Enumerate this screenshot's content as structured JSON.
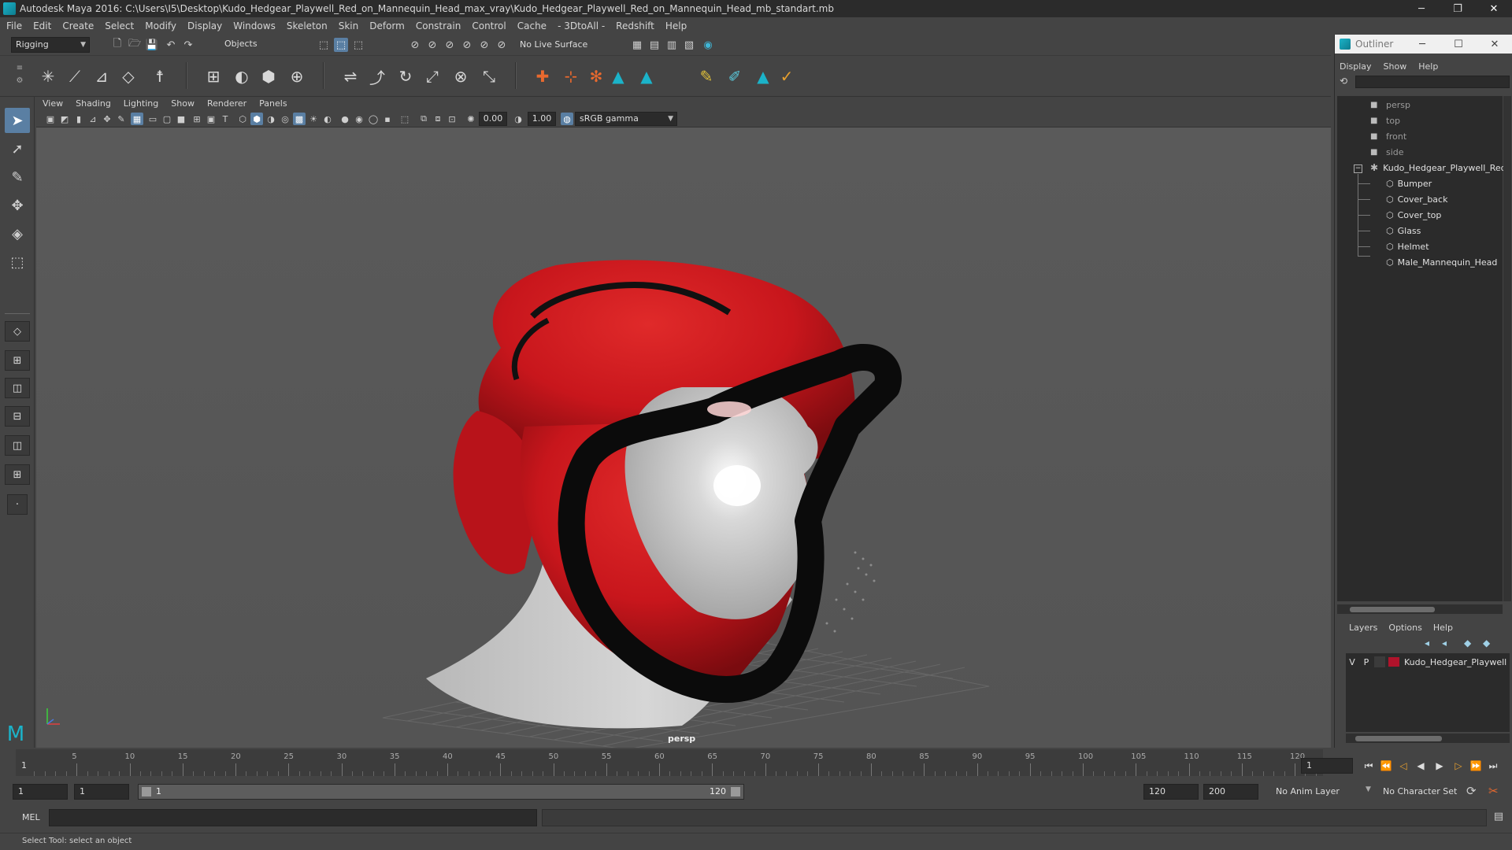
{
  "window": {
    "title": "Autodesk Maya 2016: C:\\Users\\I5\\Desktop\\Kudo_Hedgear_Playwell_Red_on_Mannequin_Head_max_vray\\Kudo_Hedgear_Playwell_Red_on_Mannequin_Head_mb_standart.mb",
    "minimize": "─",
    "restore": "❐",
    "close": "✕"
  },
  "menubar": {
    "items": [
      "File",
      "Edit",
      "Create",
      "Select",
      "Modify",
      "Display",
      "Windows",
      "Skeleton",
      "Skin",
      "Deform",
      "Constrain",
      "Control",
      "Cache",
      "- 3DtoAll -",
      "Redshift",
      "Help"
    ]
  },
  "statusline": {
    "mode": "Rigging",
    "selection_mode": "Objects",
    "live_surface": "No Live Surface"
  },
  "viewport_panel": {
    "menu": [
      "View",
      "Shading",
      "Lighting",
      "Show",
      "Renderer",
      "Panels"
    ],
    "exposure": "0.00",
    "gamma": "1.00",
    "color_space": "sRGB gamma",
    "camera_label": "persp"
  },
  "outliner": {
    "title": "Outliner",
    "menu": [
      "Display",
      "Show",
      "Help"
    ],
    "cameras": [
      "persp",
      "top",
      "front",
      "side"
    ],
    "group": "Kudo_Hedgear_Playwell_Red",
    "children": [
      "Bumper",
      "Cover_back",
      "Cover_top",
      "Glass",
      "Helmet",
      "Male_Mannequin_Head"
    ],
    "minimize": "─",
    "maximize": "☐",
    "close": "✕"
  },
  "layer_editor": {
    "menu": [
      "Layers",
      "Options",
      "Help"
    ],
    "layer": {
      "visible": "V",
      "playback": "P",
      "name": "Kudo_Hedgear_Playwell",
      "color": "#b0132b"
    }
  },
  "timeslider": {
    "ticks": [
      "5",
      "10",
      "15",
      "20",
      "25",
      "30",
      "35",
      "40",
      "45",
      "50",
      "55",
      "60",
      "65",
      "70",
      "75",
      "80",
      "85",
      "90",
      "95",
      "100",
      "105",
      "110",
      "115",
      "120"
    ],
    "start_label": "1",
    "current_frame": "1"
  },
  "range": {
    "start": "1",
    "playback_start": "1",
    "range_start_label": "1",
    "range_end_label": "120",
    "playback_end": "120",
    "end": "200",
    "anim_layer": "No Anim Layer",
    "character_set": "No Character Set"
  },
  "cmdline": {
    "language": "MEL"
  },
  "helpline": {
    "text": "Select Tool: select an object"
  },
  "colors": {
    "accent": "#5a7fa3",
    "helmet_red": "#c8161c",
    "maya_teal": "#1bb3c9"
  }
}
